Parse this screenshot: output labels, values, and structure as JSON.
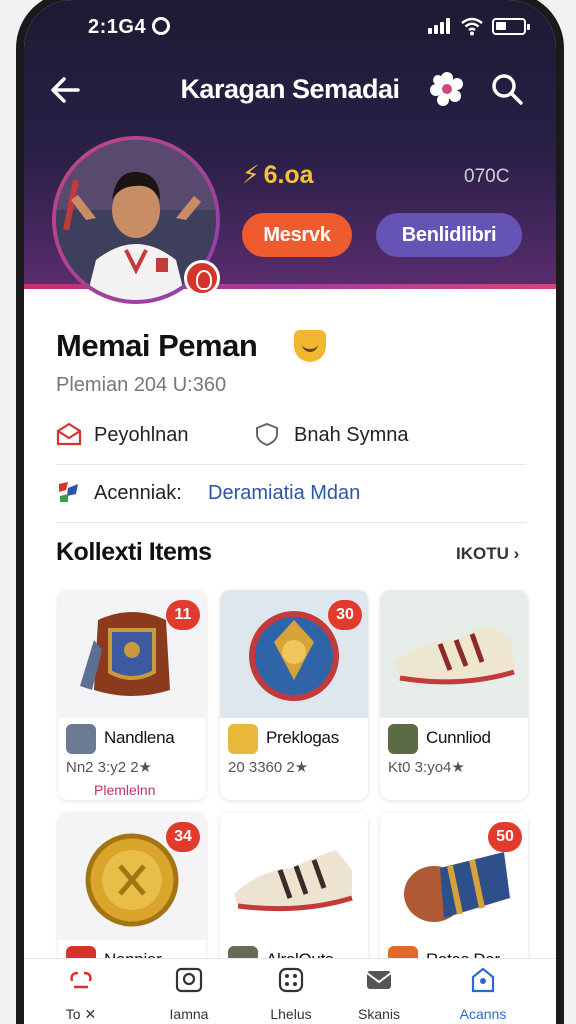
{
  "status_bar": {
    "time": "2:1G4"
  },
  "app_bar": {
    "title": "Karagan Semadai",
    "back_icon": "arrow-left-icon",
    "settings_icon": "gear-icon",
    "search_icon": "search-icon"
  },
  "profile": {
    "coins": "6.oa",
    "stat_right": "070C",
    "primary_button": "Mesrvk",
    "secondary_button": "Benlidlibri",
    "name": "Memai Peman",
    "subtitle": "Plemian 204 U:360"
  },
  "info": {
    "row1_left": "Peyohlnan",
    "row1_right": "Bnah Symna",
    "row2_label": "Acenniak:",
    "row2_value": "Deramiatia Mdan"
  },
  "collection": {
    "title": "Kollexti Items",
    "see_all": "IKOTU ›",
    "items": [
      {
        "count": "11",
        "name": "Nandlena",
        "value": "Nn2 3:y2 2★",
        "tag": "Plemlelnn"
      },
      {
        "count": "30",
        "name": "Preklogas",
        "value": "20 3360 2★",
        "tag": ""
      },
      {
        "count": "",
        "name": "Cunnliod",
        "value": "Kt0 3:yo4★",
        "tag": ""
      },
      {
        "count": "34",
        "name": "Nanpier",
        "value": "",
        "tag": ""
      },
      {
        "count": "",
        "name": "AlrolOuts",
        "value": "",
        "tag": ""
      },
      {
        "count": "50",
        "name": "Ratas Dar",
        "value": "",
        "tag": ""
      }
    ]
  },
  "tab_bar": {
    "tabs": [
      {
        "label": "To ✕",
        "icon": "home-icon"
      },
      {
        "label": "Iamna",
        "icon": "image-icon"
      },
      {
        "label": "Lhelus",
        "icon": "grid-icon"
      },
      {
        "label": "Skanis",
        "icon": "mail-icon"
      },
      {
        "label": "Acanns",
        "icon": "account-icon"
      }
    ],
    "active_index": 4
  },
  "colors": {
    "header_dark": "#1d1a33",
    "accent_pink": "#c72e6e",
    "button_orange": "#ee5b2f",
    "button_purple": "#6554b5",
    "coin_gold": "#f5c13a",
    "badge_red": "#e23a2c",
    "link_blue": "#2c55a8",
    "tab_active": "#2c6ad0"
  }
}
